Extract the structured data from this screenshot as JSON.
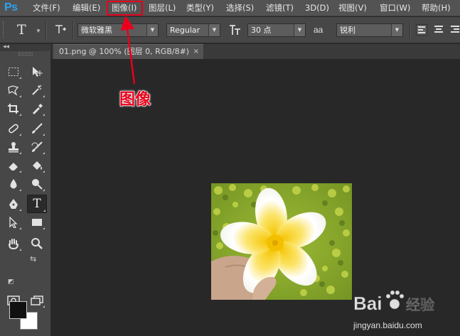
{
  "app": {
    "logo": "Ps"
  },
  "menu": {
    "items": [
      "文件(F)",
      "编辑(E)",
      "图像(I)",
      "图层(L)",
      "类型(Y)",
      "选择(S)",
      "滤镜(T)",
      "3D(D)",
      "视图(V)",
      "窗口(W)",
      "帮助(H)"
    ],
    "highlighted": "图像(I)"
  },
  "options": {
    "font_family": "微软雅黑",
    "font_style": "Regular",
    "font_size": "30 点",
    "antialias_icon_text": "aa",
    "antialias": "锐利"
  },
  "document": {
    "tab_title": "01.png @ 100% (图层 0, RGB/8#)",
    "close_glyph": "×"
  },
  "annotation": {
    "label": "图像",
    "color": "#e8001c"
  },
  "colors": {
    "foreground": "#111111",
    "background": "#ffffff",
    "accent_red": "#e8001c",
    "ps_blue": "#2fa3f0"
  },
  "watermark": {
    "brand": "Bai",
    "brand_suffix": "经验",
    "url": "jingyan.baidu.com"
  }
}
